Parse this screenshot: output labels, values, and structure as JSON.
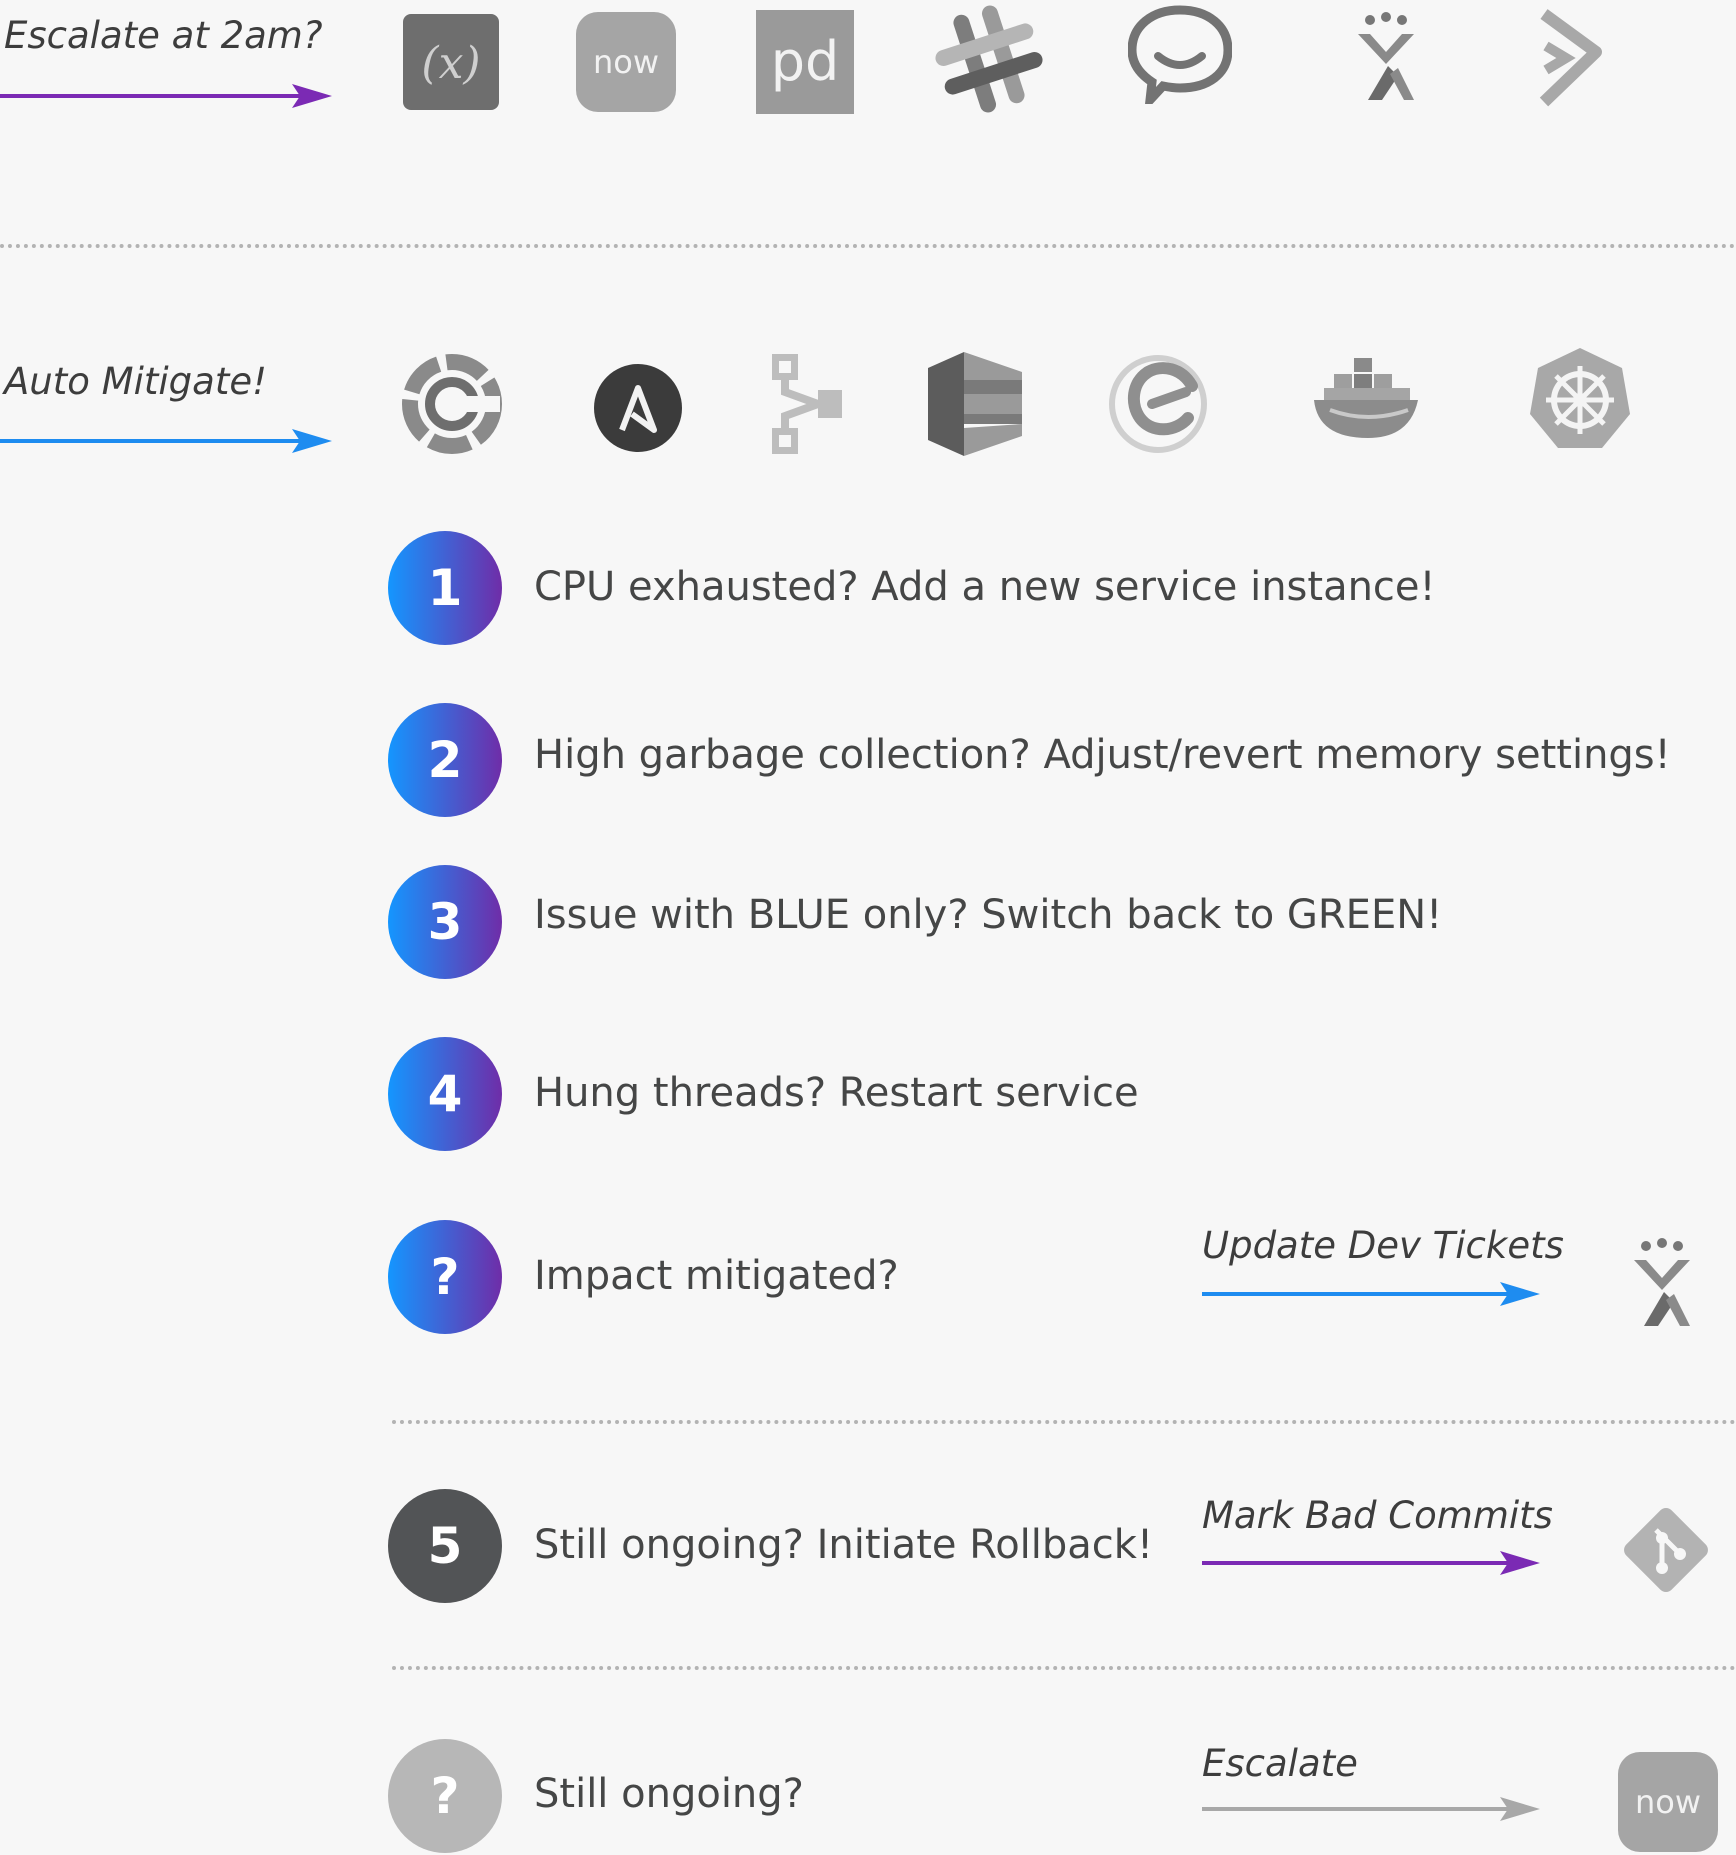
{
  "colors": {
    "purple": "#7b2ab4",
    "blue": "#1e8cf0",
    "gray": "#a8a8a8",
    "badge_gradient_start": "#1496ff",
    "badge_gradient_end": "#6f2da8",
    "badge_dark": "#525456",
    "badge_light": "#b7b7b7"
  },
  "escalate_section": {
    "label": "Escalate at 2am?",
    "logos": [
      {
        "name": "xmatters",
        "text": "(x)"
      },
      {
        "name": "servicenow",
        "text": "now"
      },
      {
        "name": "pagerduty",
        "text": "pd"
      },
      {
        "name": "slack"
      },
      {
        "name": "hipchat"
      },
      {
        "name": "jira"
      },
      {
        "name": "victorops"
      }
    ]
  },
  "mitigate_section": {
    "label": "Auto Mitigate!",
    "logos": [
      {
        "name": "chef"
      },
      {
        "name": "ansible",
        "text": "A"
      },
      {
        "name": "pipeline"
      },
      {
        "name": "aws-codedeploy"
      },
      {
        "name": "electriccloud"
      },
      {
        "name": "docker"
      },
      {
        "name": "kubernetes"
      }
    ]
  },
  "steps": [
    {
      "badge": "1",
      "text": "CPU exhausted? Add a new service instance!"
    },
    {
      "badge": "2",
      "text": "High garbage collection? Adjust/revert memory settings!"
    },
    {
      "badge": "3",
      "text": "Issue with BLUE only? Switch back to GREEN!"
    },
    {
      "badge": "4",
      "text": "Hung threads? Restart service"
    },
    {
      "badge": "?",
      "text": "Impact mitigated?",
      "action": "Update Dev Tickets",
      "target_icon": "jira"
    },
    {
      "badge": "5",
      "text": "Still ongoing? Initiate Rollback!",
      "action": "Mark Bad Commits",
      "target_icon": "git"
    },
    {
      "badge": "?",
      "text": "Still ongoing?",
      "action": "Escalate",
      "target_icon": "servicenow",
      "target_text": "now"
    }
  ]
}
